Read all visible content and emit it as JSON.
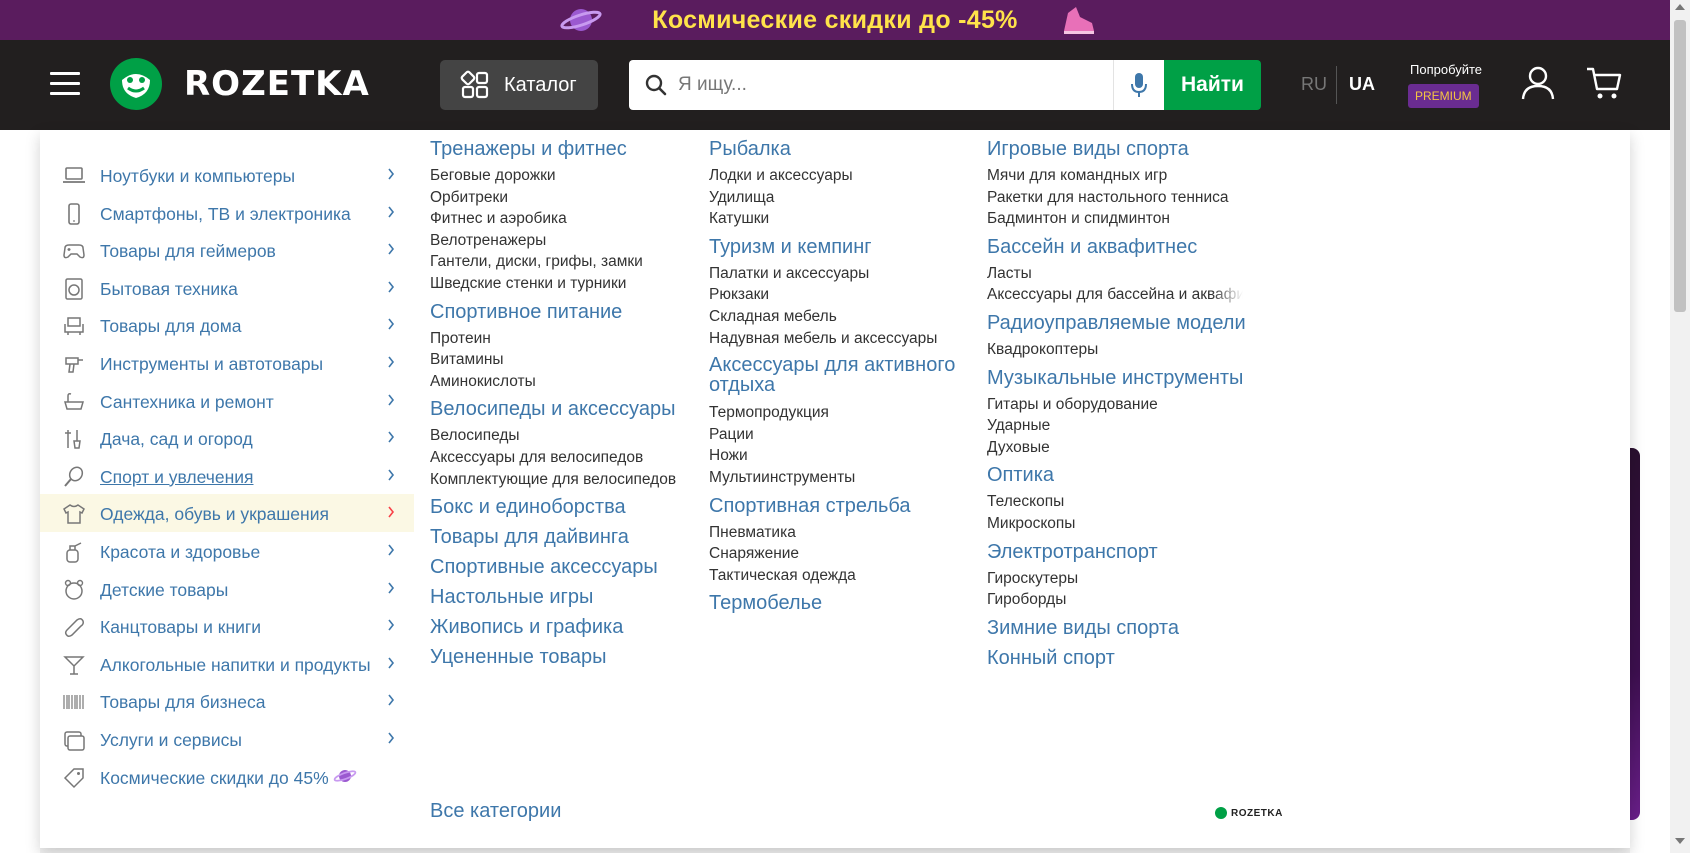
{
  "promo": {
    "text": "Космические скидки до -45%"
  },
  "header": {
    "logo_text": "ROZETKA",
    "catalog_label": "Каталог",
    "search_placeholder": "Я ищу...",
    "find_label": "Найти",
    "lang_ru": "RU",
    "lang_ua": "UA",
    "try_text": "Попробуйте",
    "premium_label": "PREMIUM"
  },
  "colors": {
    "brand_green": "#00a046",
    "header_bg": "#221f1f",
    "promo_bg": "#5a1c5e",
    "link_blue": "#3e77aa",
    "premium_purple": "#6a2c91"
  },
  "sidebar": {
    "items": [
      {
        "label": "Ноутбуки и компьютеры",
        "icon": "laptop-icon"
      },
      {
        "label": "Смартфоны, ТВ и электроника",
        "icon": "smartphone-icon"
      },
      {
        "label": "Товары для геймеров",
        "icon": "gamepad-icon"
      },
      {
        "label": "Бытовая техника",
        "icon": "washing-machine-icon"
      },
      {
        "label": "Товары для дома",
        "icon": "armchair-icon"
      },
      {
        "label": "Инструменты и автотовары",
        "icon": "drill-icon"
      },
      {
        "label": "Сантехника и ремонт",
        "icon": "bathtub-icon"
      },
      {
        "label": "Дача, сад и огород",
        "icon": "garden-tools-icon"
      },
      {
        "label": "Спорт и увлечения",
        "icon": "racket-icon"
      },
      {
        "label": "Одежда, обувь и украшения",
        "icon": "tshirt-icon"
      },
      {
        "label": "Красота и здоровье",
        "icon": "perfume-icon"
      },
      {
        "label": "Детские товары",
        "icon": "teddy-bear-icon"
      },
      {
        "label": "Канцтовары и книги",
        "icon": "paperclip-icon"
      },
      {
        "label": "Алкогольные напитки и продукты",
        "icon": "cocktail-icon"
      },
      {
        "label": "Товары для бизнеса",
        "icon": "barcode-icon"
      },
      {
        "label": "Услуги и сервисы",
        "icon": "services-icon"
      },
      {
        "label": "Космические скидки до 45%",
        "icon": "tag-icon"
      }
    ]
  },
  "columns": [
    {
      "groups": [
        {
          "title": "Тренажеры и фитнес",
          "items": [
            "Беговые дорожки",
            "Орбитреки",
            "Фитнес и аэробика",
            "Велотренажеры",
            "Гантели, диски, грифы, замки",
            "Шведские стенки и турники"
          ]
        },
        {
          "title": "Спортивное питание",
          "items": [
            "Протеин",
            "Витамины",
            "Аминокислоты"
          ]
        },
        {
          "title": "Велосипеды и аксессуары",
          "items": [
            "Велосипеды",
            "Аксессуары для велосипедов",
            "Комплектующие для велосипедов"
          ]
        },
        {
          "title": "Бокс и единоборства",
          "items": []
        },
        {
          "title": "Товары для дайвинга",
          "items": []
        },
        {
          "title": "Спортивные аксессуары",
          "items": []
        },
        {
          "title": "Настольные игры",
          "items": []
        },
        {
          "title": "Живопись и графика",
          "items": []
        },
        {
          "title": "Уцененные товары",
          "items": []
        }
      ]
    },
    {
      "groups": [
        {
          "title": "Рыбалка",
          "items": [
            "Лодки и аксессуары",
            "Удилища",
            "Катушки"
          ]
        },
        {
          "title": "Туризм и кемпинг",
          "items": [
            "Палатки и аксессуары",
            "Рюкзаки",
            "Складная мебель",
            "Надувная мебель и аксессуары"
          ]
        },
        {
          "title": "Аксессуары для активного отдыха",
          "items": [
            "Термопродукция",
            "Рации",
            "Ножи",
            "Мультиинструменты"
          ]
        },
        {
          "title": "Спортивная стрельба",
          "items": [
            "Пневматика",
            "Снаряжение",
            "Тактическая одежда"
          ]
        },
        {
          "title": "Термобелье",
          "items": []
        }
      ]
    },
    {
      "groups": [
        {
          "title": "Игровые виды спорта",
          "items": [
            "Мячи для командных игр",
            "Ракетки для настольного тенниса",
            "Бадминтон и спидминтон"
          ]
        },
        {
          "title": "Бассейн и аквафитнес",
          "items": [
            "Ласты",
            "Аксессуары для бассейна и аквафит"
          ]
        },
        {
          "title": "Радиоуправляемые модели",
          "items": [
            "Квадрокоптеры"
          ]
        },
        {
          "title": "Музыкальные инструменты",
          "items": [
            "Гитары и оборудование",
            "Ударные",
            "Духовые"
          ]
        },
        {
          "title": "Оптика",
          "items": [
            "Телескопы",
            "Микроскопы"
          ]
        },
        {
          "title": "Электротранспорт",
          "items": [
            "Гироскутеры",
            "Гироборды"
          ]
        },
        {
          "title": "Зимние виды спорта",
          "items": []
        },
        {
          "title": "Конный спорт",
          "items": []
        }
      ]
    }
  ],
  "footer": {
    "all_categories": "Все категории",
    "small_logo": "ROZETKA"
  }
}
